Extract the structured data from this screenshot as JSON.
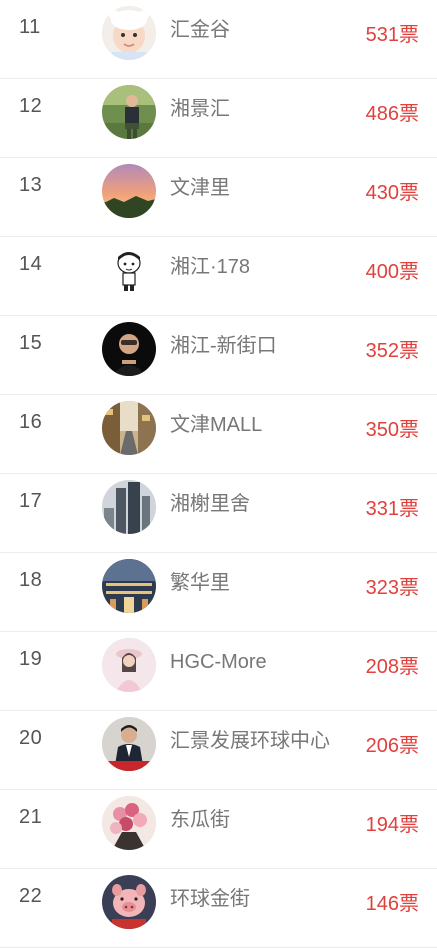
{
  "rankings": [
    {
      "rank": "11",
      "name": "汇金谷",
      "votes": "531票",
      "avatar": "baby-avatar"
    },
    {
      "rank": "12",
      "name": "湘景汇",
      "votes": "486票",
      "avatar": "man-outdoor-avatar"
    },
    {
      "rank": "13",
      "name": "文津里",
      "votes": "430票",
      "avatar": "sunset-avatar"
    },
    {
      "rank": "14",
      "name": "湘江·178",
      "votes": "400票",
      "avatar": "cartoon-boy-avatar"
    },
    {
      "rank": "15",
      "name": "湘江-新街口",
      "votes": "352票",
      "avatar": "man-dark-avatar"
    },
    {
      "rank": "16",
      "name": "文津MALL",
      "votes": "350票",
      "avatar": "street-avatar"
    },
    {
      "rank": "17",
      "name": "湘榭里舍",
      "votes": "331票",
      "avatar": "tower-avatar"
    },
    {
      "rank": "18",
      "name": "繁华里",
      "votes": "323票",
      "avatar": "mall-avatar"
    },
    {
      "rank": "19",
      "name": "HGC-More",
      "votes": "208票",
      "avatar": "girl-avatar"
    },
    {
      "rank": "20",
      "name": "汇景发展环球中心",
      "votes": "206票",
      "avatar": "man-suit-avatar"
    },
    {
      "rank": "21",
      "name": "东瓜街",
      "votes": "194票",
      "avatar": "flowers-avatar"
    },
    {
      "rank": "22",
      "name": "环球金街",
      "votes": "146票",
      "avatar": "pig-avatar"
    }
  ],
  "colors": {
    "vote": "#e0413d",
    "rank": "#555555",
    "name": "#777777"
  }
}
